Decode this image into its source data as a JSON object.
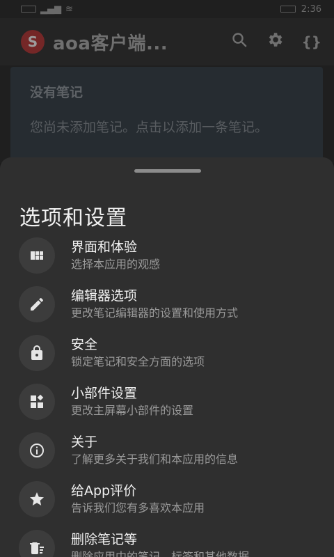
{
  "status_bar": {
    "time": "2:36"
  },
  "app_bar": {
    "logo_glyph": "S",
    "title": "aoa客户端...",
    "actions": {
      "search_icon": "search-icon",
      "settings_icon": "gear-icon",
      "json_label": "{}"
    }
  },
  "note_card": {
    "title": "没有笔记",
    "body": "您尚未添加笔记。点击以添加一条笔记。"
  },
  "sheet": {
    "title": "选项和设置",
    "options": [
      {
        "label": "界面和体验",
        "description": "选择本应用的观感",
        "icon": "dashboard-icon"
      },
      {
        "label": "编辑器选项",
        "description": "更改笔记编辑器的设置和使用方式",
        "icon": "pencil-icon"
      },
      {
        "label": "安全",
        "description": "锁定笔记和安全方面的选项",
        "icon": "lock-icon"
      },
      {
        "label": "小部件设置",
        "description": "更改主屏幕小部件的设置",
        "icon": "widgets-icon"
      },
      {
        "label": "关于",
        "description": "了解更多关于我们和本应用的信息",
        "icon": "info-icon"
      },
      {
        "label": "给App评价",
        "description": "告诉我们您有多喜欢本应用",
        "icon": "star-icon"
      },
      {
        "label": "删除笔记等",
        "description": "删除应用中的笔记、标签和其他数据",
        "icon": "delete-icon"
      }
    ]
  }
}
